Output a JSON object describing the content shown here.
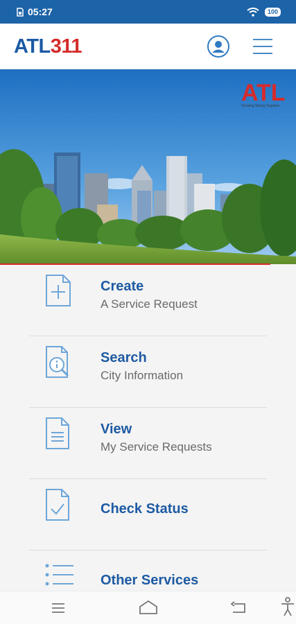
{
  "status_bar": {
    "time": "05:27",
    "battery": "100"
  },
  "header": {
    "logo_atl": "ATL",
    "logo_num": "311"
  },
  "hero": {
    "brand_mark": "ATL",
    "brand_tagline": "Growing Strong Together"
  },
  "menu": {
    "items": [
      {
        "title": "Create",
        "subtitle": "A Service Request",
        "icon": "add-document-icon"
      },
      {
        "title": "Search",
        "subtitle": "City Information",
        "icon": "info-search-icon"
      },
      {
        "title": "View",
        "subtitle": "My Service Requests",
        "icon": "document-icon"
      },
      {
        "title": "Check Status",
        "subtitle": "",
        "icon": "checked-document-icon"
      },
      {
        "title": "Other Services",
        "subtitle": "",
        "icon": "list-icon"
      }
    ]
  },
  "colors": {
    "brand_blue": "#1b5aa6",
    "brand_red": "#d52b2b",
    "status_bar": "#1c63a8",
    "icon_blue": "#6ea6d8"
  }
}
